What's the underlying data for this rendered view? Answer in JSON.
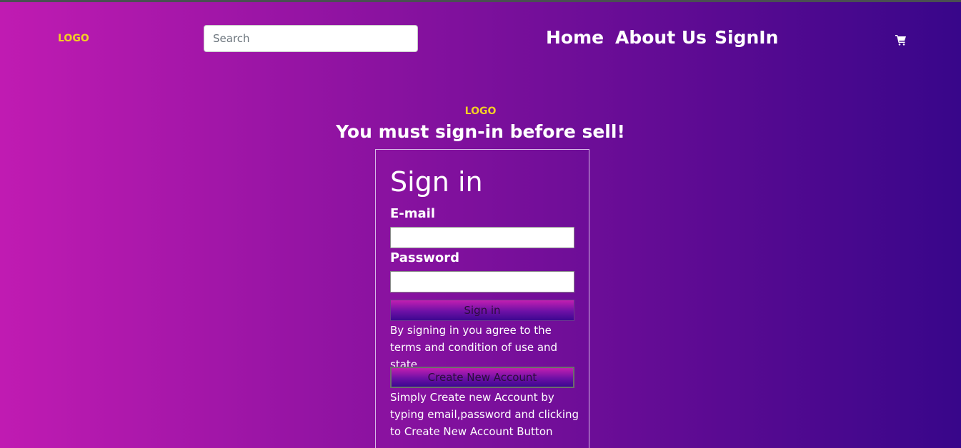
{
  "header": {
    "logo": "LOGO",
    "search_placeholder": "Search",
    "nav": {
      "home": "Home",
      "about": "About Us",
      "signin": "SignIn"
    },
    "cart_icon": "shopping-cart-icon"
  },
  "main": {
    "logo": "LOGO",
    "headline": "You must sign-in before sell!",
    "form": {
      "title": "Sign in",
      "email_label": "E-mail",
      "email_value": "",
      "password_label": "Password",
      "password_value": "",
      "signin_button": "Sign in",
      "terms_note": "By signing in you agree to the terms and condition of use and state.",
      "create_button": "Create New Account",
      "create_note": "Simply Create new Account by typing email,password and clicking to Create New Account Button"
    }
  },
  "colors": {
    "logo": "#f3cf25",
    "gradient_left": "#c01bb2",
    "gradient_right": "#38068a",
    "text": "#ffffff"
  }
}
